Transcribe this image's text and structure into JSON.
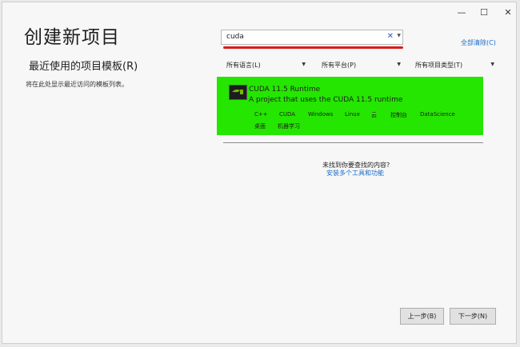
{
  "window": {
    "minimize_glyph": "—",
    "maximize_glyph": "☐",
    "close_glyph": "✕"
  },
  "page_title": "创建新项目",
  "recent": {
    "title": "最近使用的项目模板(R)",
    "empty_text": "将在此处显示最近访问的模板列表。"
  },
  "search": {
    "value": "cuda",
    "clear_glyph": "✕",
    "dropdown_glyph": "▼",
    "clear_all": "全部清除(C)"
  },
  "filters": [
    {
      "label": "所有语言(L)"
    },
    {
      "label": "所有平台(P)"
    },
    {
      "label": "所有项目类型(T)"
    }
  ],
  "template": {
    "name_prefix": "CUDA",
    "name_rest": " 11.5 Runtime",
    "desc_prefix": "A project that uses the ",
    "desc_highlight": "CUDA",
    "desc_suffix": " 11.5 runtime",
    "tags_row1": [
      "C++",
      "CUDA",
      "Windows",
      "Linux",
      "云",
      "控制台",
      "DataScience"
    ],
    "tags_row2": [
      "桌面",
      "机器学习"
    ],
    "highlight_color": "#25e600"
  },
  "help": {
    "not_found": "未找到你要查找的内容?",
    "install_link": "安装多个工具和功能"
  },
  "buttons": {
    "back": "上一步(B)",
    "next": "下一步(N)"
  }
}
